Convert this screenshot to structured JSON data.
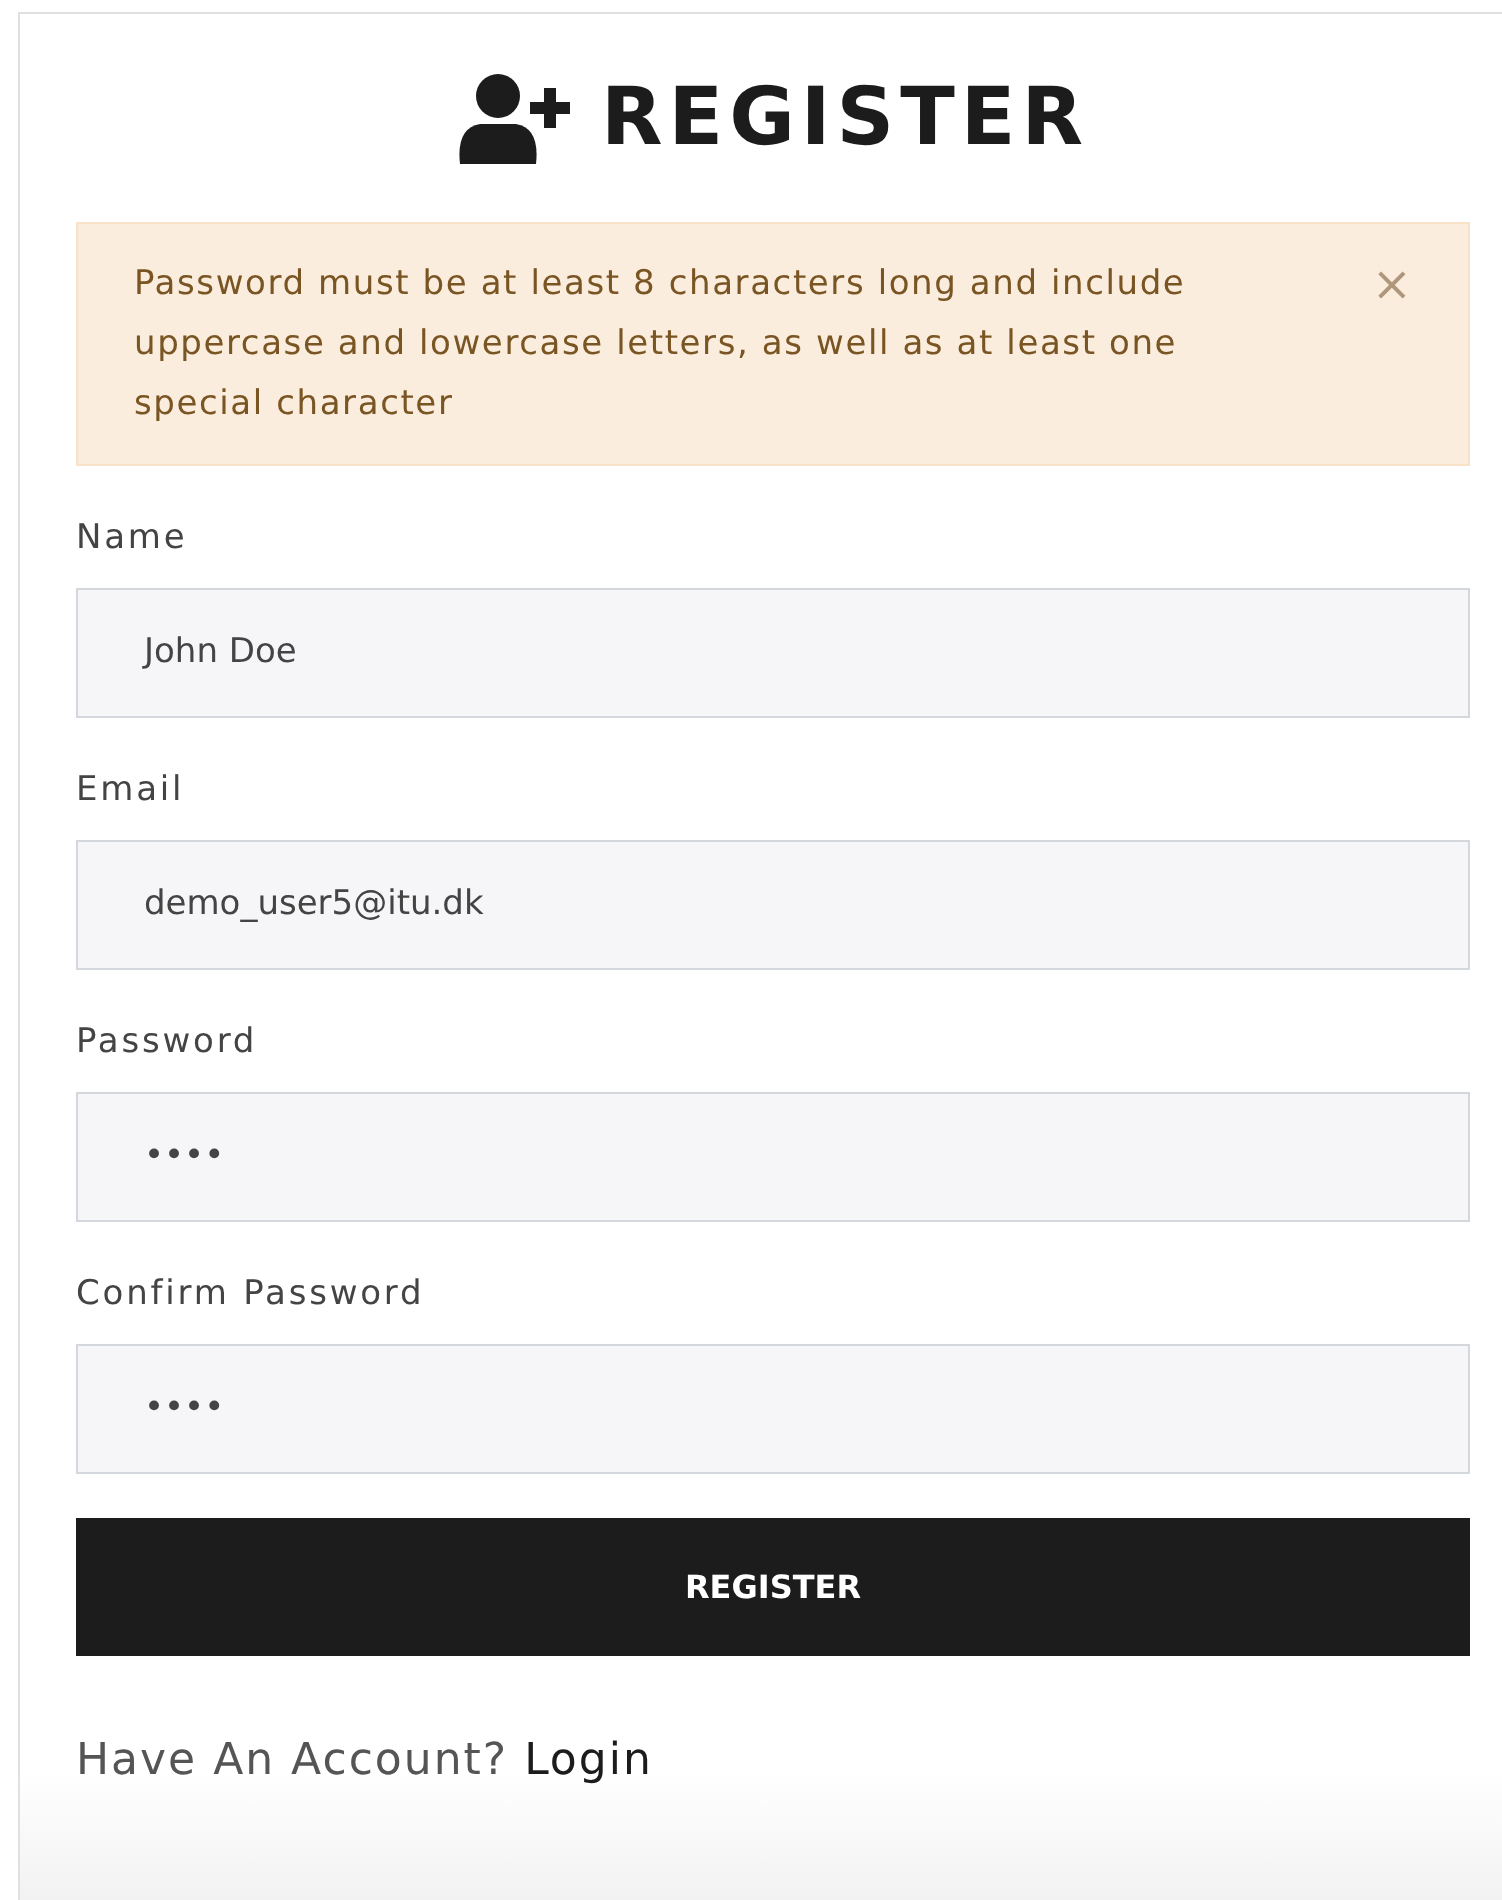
{
  "title": "REGISTER",
  "alert": {
    "message": "Password must be at least 8 characters long and include uppercase and lowercase letters, as well as at least one special character",
    "close": "×"
  },
  "fields": [
    {
      "label": "Name",
      "value": "John Doe"
    },
    {
      "label": "Email",
      "value": "demo_user5@itu.dk"
    },
    {
      "label": "Password",
      "value": "••••"
    },
    {
      "label": "Confirm Password",
      "value": "••••"
    }
  ],
  "submit": "REGISTER",
  "footer": {
    "prompt": "Have An Account?",
    "link": "Login"
  }
}
